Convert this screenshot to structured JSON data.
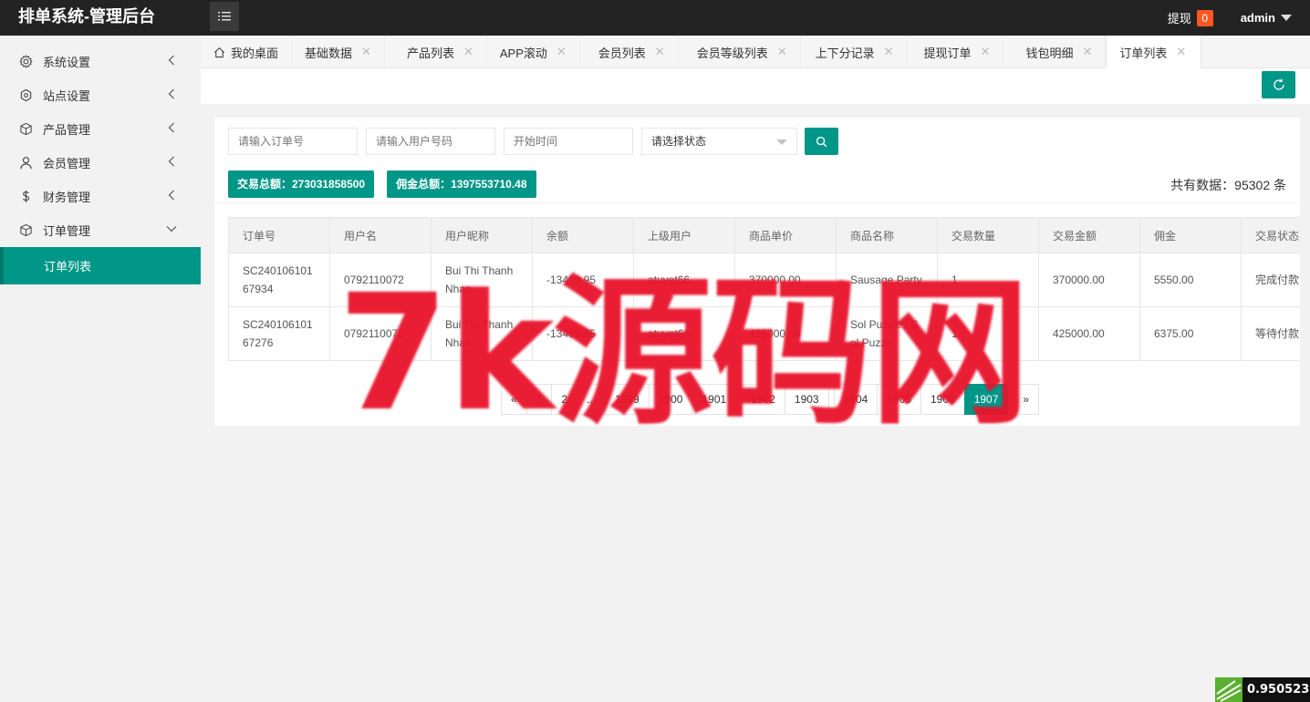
{
  "app": {
    "title": "排单系统-管理后台"
  },
  "header": {
    "withdraw_label": "提现",
    "withdraw_count": "0",
    "user_name": "admin"
  },
  "sidebar": {
    "items": [
      {
        "label": "系统设置",
        "icon": "gear-icon"
      },
      {
        "label": "站点设置",
        "icon": "site-icon"
      },
      {
        "label": "产品管理",
        "icon": "box-icon"
      },
      {
        "label": "会员管理",
        "icon": "user-icon"
      },
      {
        "label": "财务管理",
        "icon": "dollar-icon"
      },
      {
        "label": "订单管理",
        "icon": "order-icon"
      }
    ],
    "sub_active": "订单列表"
  },
  "tabs": [
    {
      "label": "我的桌面"
    },
    {
      "label": "基础数据"
    },
    {
      "label": "产品列表"
    },
    {
      "label": "APP滚动"
    },
    {
      "label": "会员列表"
    },
    {
      "label": "会员等级列表"
    },
    {
      "label": "上下分记录"
    },
    {
      "label": "提现订单"
    },
    {
      "label": "钱包明细"
    },
    {
      "label": "订单列表"
    }
  ],
  "filters": {
    "order_no_placeholder": "请输入订单号",
    "user_phone_placeholder": "请输入用户号码",
    "start_time_placeholder": "开始时间",
    "status_select": "请选择状态"
  },
  "stats": {
    "trade_total": "交易总额：273031858500",
    "commission_total": "佣金总额：1397553710.48",
    "record_count": "共有数据：95302 条"
  },
  "table": {
    "headers": [
      "订单号",
      "用户名",
      "用户昵称",
      "余额",
      "上级用户",
      "商品单价",
      "商品名称",
      "交易数量",
      "交易金额",
      "佣金",
      "交易状态"
    ],
    "rows": [
      [
        "SC24010610167934",
        "0792110072",
        "Bui Thi Thanh Nhan",
        "-13409.95",
        "atuyet66",
        "370000.00",
        "Sausage Party",
        "1",
        "370000.00",
        "5550.00",
        "完成付款"
      ],
      [
        "SC24010610167276",
        "0792110072",
        "Bui Thi Thanh Nhan",
        "-13409.95",
        "atuyet66",
        "425000.00",
        "Sol Puzzle / Sol Puzzle",
        "1",
        "425000.00",
        "6375.00",
        "等待付款"
      ]
    ]
  },
  "pagination": {
    "items": [
      "«",
      "1",
      "2",
      "...",
      "1899",
      "1900",
      "1901",
      "1902",
      "1903",
      "1904",
      "1905",
      "1906",
      "1907",
      "»"
    ],
    "current": "1907"
  },
  "watermark": "7k源码网",
  "fps_value": "0.950523s",
  "colors": {
    "accent": "#009688",
    "topbar": "#232323",
    "badge": "#ff5722",
    "watermark": "#e8132b"
  }
}
